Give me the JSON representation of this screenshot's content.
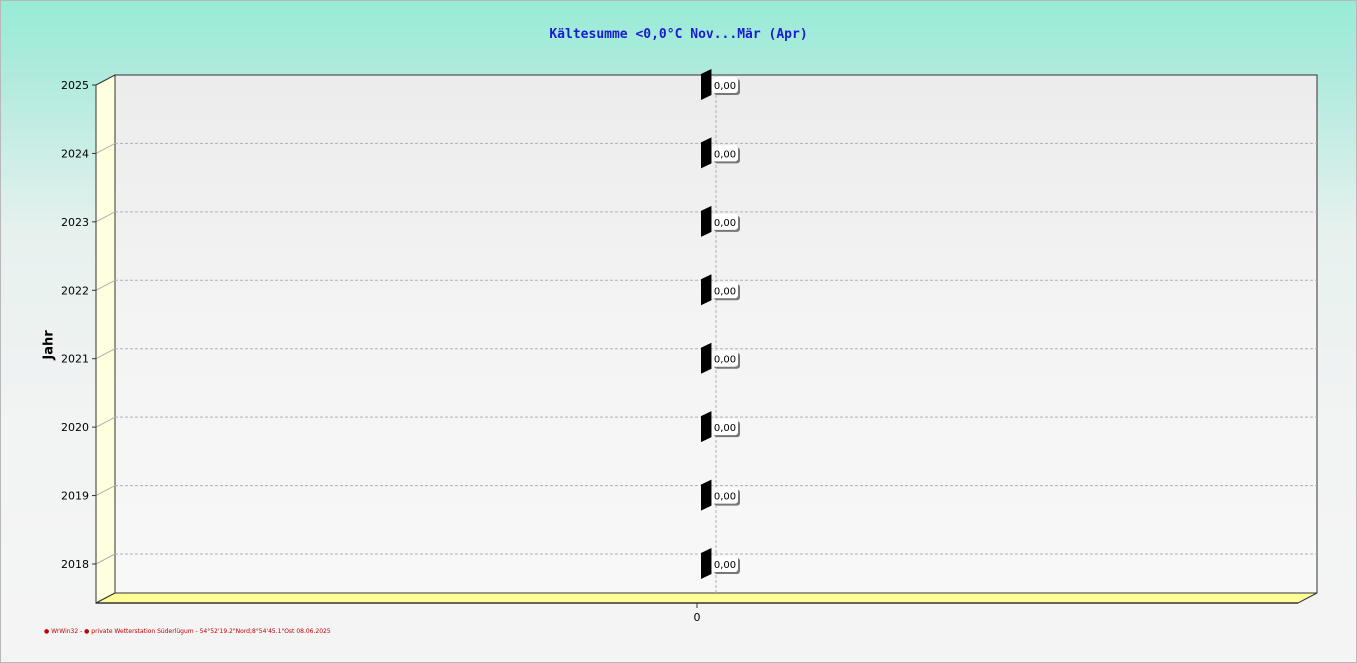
{
  "chart_data": {
    "type": "bar",
    "orientation": "horizontal",
    "title": "Kältesumme  <0,0°C  Nov...Mär (Apr)",
    "ylabel": "Jahr",
    "xlabel": "",
    "categories": [
      "2025",
      "2024",
      "2023",
      "2022",
      "2021",
      "2020",
      "2019",
      "2018"
    ],
    "values": [
      0,
      0,
      0,
      0,
      0,
      0,
      0,
      0
    ],
    "data_labels": [
      "0,00",
      "0,00",
      "0,00",
      "0,00",
      "0,00",
      "0,00",
      "0,00",
      "0,00"
    ],
    "x_ticks": [
      "0"
    ],
    "x_tick_values": [
      0
    ],
    "grid": true,
    "three_d": true,
    "colors": {
      "title": "#1b1bd0",
      "bar": "#000000",
      "floor": "#ffff99",
      "side_wall": "#ffffe0",
      "footer": "#c00000"
    }
  },
  "footer": "● WrWin32  -  ● private Wetterstation Süderlügum  -  54°52'19.2\"Nord;8°54'45.1\"Ost  08.06.2025"
}
